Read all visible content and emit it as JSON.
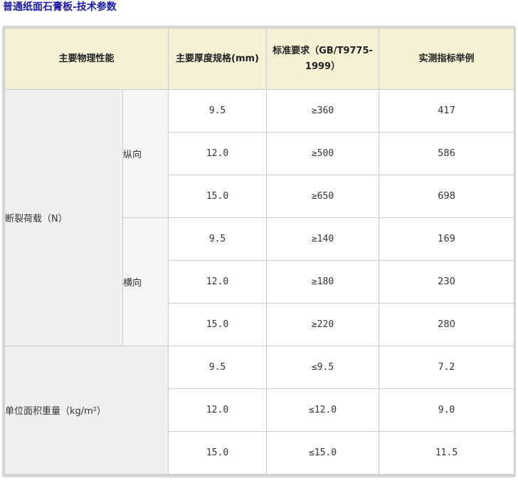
{
  "page": {
    "title": "普通纸面石膏板-技术参数"
  },
  "table": {
    "headers": [
      "主要物理性能",
      "主要厚度规格(mm)",
      "标准要求（GB/T9775-1999）",
      "实测指标举例"
    ],
    "groups": [
      {
        "name": "断裂荷载（N）",
        "subgroups": [
          {
            "name": "纵向",
            "rows": [
              {
                "thickness": "9.5",
                "standard": "≥360",
                "measured": "417"
              },
              {
                "thickness": "12.0",
                "standard": "≥500",
                "measured": "586"
              },
              {
                "thickness": "15.0",
                "standard": "≥650",
                "measured": "698"
              }
            ]
          },
          {
            "name": "横向",
            "rows": [
              {
                "thickness": "9.5",
                "standard": "≥140",
                "measured": "169"
              },
              {
                "thickness": "12.0",
                "standard": "≥180",
                "measured": "230"
              },
              {
                "thickness": "15.0",
                "standard": "≥220",
                "measured": "280"
              }
            ]
          }
        ]
      },
      {
        "name": "单位面积重量（kg/m²）",
        "rows": [
          {
            "thickness": "9.5",
            "standard": "≤9.5",
            "measured": "7.2"
          },
          {
            "thickness": "12.0",
            "standard": "≤12.0",
            "measured": "9.0"
          },
          {
            "thickness": "15.0",
            "standard": "≤15.0",
            "measured": "11.5"
          }
        ]
      }
    ]
  }
}
